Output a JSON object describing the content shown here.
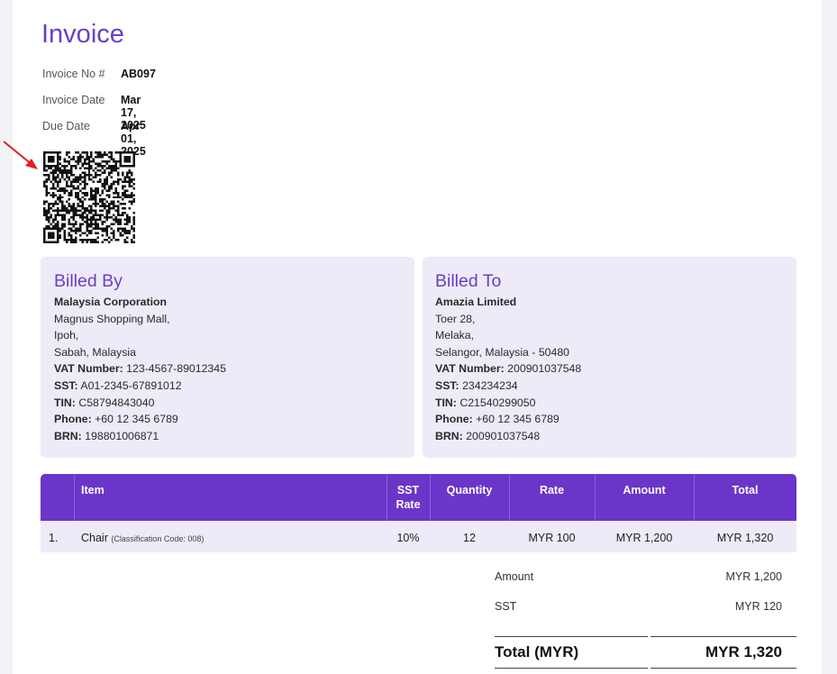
{
  "invoice": {
    "title": "Invoice",
    "number_label": "Invoice No #",
    "number": "AB097",
    "date_label": "Invoice Date",
    "date": "Mar 17, 2025",
    "due_label": "Due Date",
    "due": "Apr 01, 2025"
  },
  "billed_by": {
    "heading": "Billed By",
    "name": "Malaysia Corporation",
    "address": [
      "Magnus Shopping Mall,",
      "Ipoh,",
      "Sabah, Malaysia"
    ],
    "vat_label": "VAT Number:",
    "vat": "123-4567-89012345",
    "sst_label": "SST:",
    "sst": "A01-2345-67891012",
    "tin_label": "TIN:",
    "tin": "C58794843040",
    "phone_label": "Phone:",
    "phone": "+60 12 345 6789",
    "brn_label": "BRN:",
    "brn": "198801006871"
  },
  "billed_to": {
    "heading": "Billed To",
    "name": "Amazia Limited",
    "address": [
      "Toer 28,",
      "Melaka,",
      "Selangor, Malaysia - 50480"
    ],
    "vat_label": "VAT Number:",
    "vat": "200901037548",
    "sst_label": "SST:",
    "sst": "234234234",
    "tin_label": "TIN:",
    "tin": "C21540299050",
    "phone_label": "Phone:",
    "phone": "+60 12 345 6789",
    "brn_label": "BRN:",
    "brn": "200901037548"
  },
  "table": {
    "headers": {
      "item": "Item",
      "sst_rate_1": "SST",
      "sst_rate_2": "Rate",
      "quantity": "Quantity",
      "rate": "Rate",
      "amount": "Amount",
      "total": "Total"
    },
    "rows": [
      {
        "index": "1.",
        "item": "Chair",
        "classification": "(Classification Code: 008)",
        "sst_rate": "10%",
        "quantity": "12",
        "rate": "MYR 100",
        "amount": "MYR 1,200",
        "total": "MYR 1,320"
      }
    ]
  },
  "summary": {
    "amount_label": "Amount",
    "amount": "MYR 1,200",
    "sst_label": "SST",
    "sst": "MYR 120",
    "total_label": "Total (MYR)",
    "total": "MYR 1,320"
  },
  "colors": {
    "accent": "#6a35c9",
    "card_bg": "#eeeaf8",
    "arrow": "#e02020"
  },
  "icons": {
    "qr": "qr-code-icon",
    "arrow": "red-arrow-icon"
  }
}
